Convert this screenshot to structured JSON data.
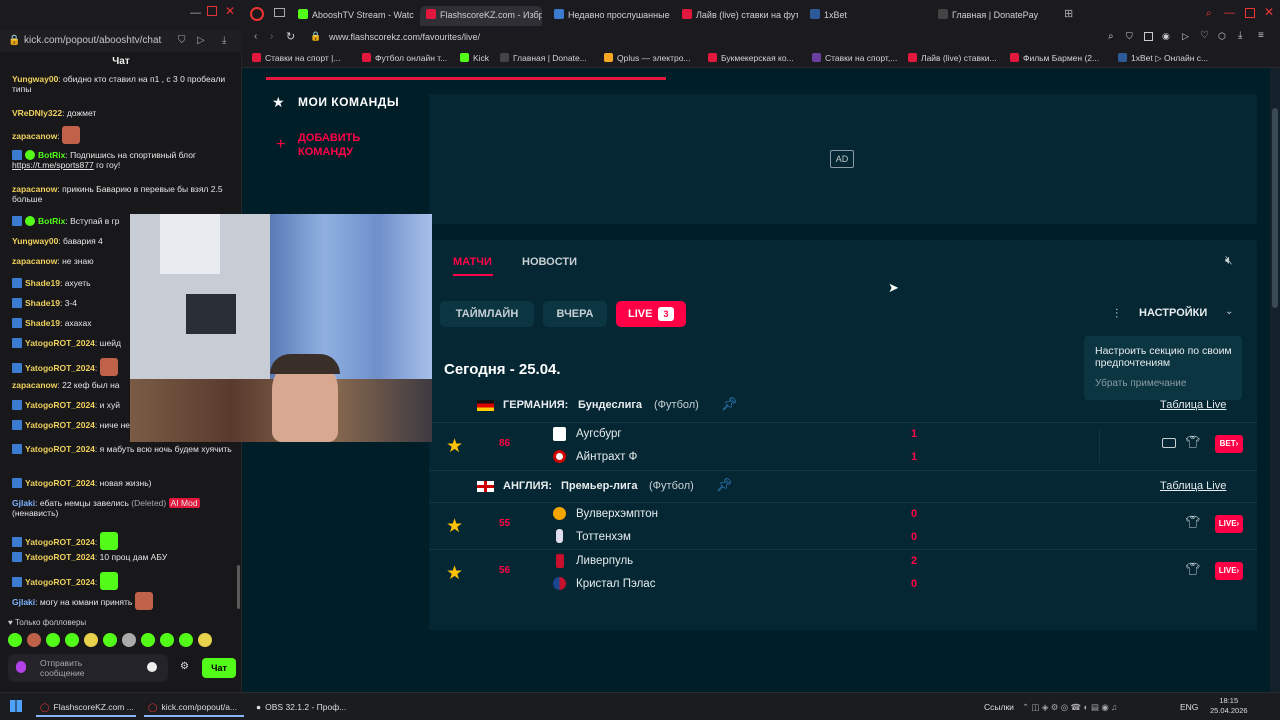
{
  "left_window": {
    "url": "kick.com/popout/abooshtv/chat",
    "title": "Чат",
    "messages": [
      {
        "user": "Yungway00",
        "text": "обидно кто ставил на п1 , с 3 0 пробеали типы",
        "color": "#f0d15c",
        "badge": "none"
      },
      {
        "user": "VReDNIy322",
        "text": "дожмет",
        "color": "#f0d15c",
        "badge": "none"
      },
      {
        "user": "zapacanow",
        "text": "",
        "color": "#f0d15c",
        "badge": "none",
        "emote": true
      },
      {
        "user": "BotRix",
        "text": "Подпишись на спортивный блог",
        "link": "https://t.me/sports877",
        "link_suffix": " го гоу!",
        "color": "#53fc18",
        "badge": "kick-green"
      },
      {
        "user": "zapacanow",
        "text": "прикинь Баварию в перевые бы взял 2.5 больше",
        "color": "#f0d15c",
        "badge": "none"
      },
      {
        "user": "BotRix",
        "text": "Вступай в гр",
        "color": "#53fc18",
        "badge": "kick-green"
      },
      {
        "user": "Yungway00",
        "text": "бавария 4",
        "color": "#f0d15c",
        "badge": "none"
      },
      {
        "user": "zapacanow",
        "text": "не знаю",
        "color": "#f0d15c",
        "badge": "none"
      },
      {
        "user": "Shade19",
        "text": "ахуеть",
        "color": "#f0d15c",
        "badge": "kick"
      },
      {
        "user": "Shade19",
        "text": "3-4",
        "color": "#f0d15c",
        "badge": "kick"
      },
      {
        "user": "Shade19",
        "text": "ахахах",
        "color": "#f0d15c",
        "badge": "kick"
      },
      {
        "user": "YatogoROT_2024",
        "text": "шейд",
        "color": "#f0d15c",
        "badge": "kick"
      },
      {
        "user": "YatogoROT_2024",
        "text": "",
        "color": "#f0d15c",
        "badge": "kick",
        "emote": true
      },
      {
        "user": "zapacanow",
        "text": "22 кеф был на",
        "color": "#f0d15c",
        "badge": "none"
      },
      {
        "user": "YatogoROT_2024",
        "text": "и хуй",
        "color": "#f0d15c",
        "badge": "kick"
      },
      {
        "user": "YatogoROT_2024",
        "text": "ниче не заказ",
        "color": "#f0d15c",
        "badge": "kick"
      },
      {
        "user": "YatogoROT_2024",
        "text": "я мабуть всю ночь будем хуячить",
        "color": "#f0d15c",
        "badge": "kick"
      },
      {
        "user": "YatogoROT_2024",
        "text": "новая жизнь)",
        "color": "#f0d15c",
        "badge": "kick"
      },
      {
        "user": "Gjlaki",
        "text": "ебать немцы завелись",
        "deleted": "(Deleted)",
        "mod": "AI Mod",
        "mod_note": "(ненависть)",
        "color": "#7fb3ff",
        "badge": "none"
      },
      {
        "user": "YatogoROT_2024",
        "text": "",
        "color": "#f0d15c",
        "badge": "kick",
        "emote": true
      },
      {
        "user": "YatogoROT_2024",
        "text": "10 проц дам АБУ",
        "color": "#f0d15c",
        "badge": "kick"
      },
      {
        "user": "YatogoROT_2024",
        "text": "",
        "color": "#f0d15c",
        "badge": "kick",
        "emote": true
      },
      {
        "user": "Gjlaki",
        "text": "могу на юмани принять",
        "color": "#7fb3ff",
        "badge": "none",
        "emote": true
      }
    ],
    "followers_only": "Только фолловеры",
    "input_placeholder": "Отправить сообщение",
    "chat_button": "Чат"
  },
  "browser": {
    "tabs": [
      {
        "label": "AbooshTV Stream - Watch",
        "color": "#53fc18"
      },
      {
        "label": "FlashscoreKZ.com - Избр",
        "color": "#e3183e",
        "active": true
      },
      {
        "label": "Недавно прослушанные",
        "color": "#3b7bd0"
      },
      {
        "label": "Лайв (live) ставки на фут",
        "color": "#e3183e"
      },
      {
        "label": "1xBet",
        "color": "#2e5a9a"
      },
      {
        "label": "Главная | DonatePay",
        "color": "#444"
      }
    ],
    "url": "www.flashscorekz.com/favourites/live/",
    "bookmarks": [
      {
        "label": "Ставки на спорт |...",
        "color": "#e3183e"
      },
      {
        "label": "Футбол онлайн т...",
        "color": "#e3183e"
      },
      {
        "label": "Kick",
        "color": "#53fc18"
      },
      {
        "label": "Главная | Donate...",
        "color": "#444"
      },
      {
        "label": "Qplus — электро...",
        "color": "#f5a623"
      },
      {
        "label": "Букмекерская ко...",
        "color": "#e3183e"
      },
      {
        "label": "Ставки на спорт,...",
        "color": "#6a3fa0"
      },
      {
        "label": "Лайв (live) ставки...",
        "color": "#e3183e"
      },
      {
        "label": "Фильм Бармен (2...",
        "color": "#e3183e"
      },
      {
        "label": "1xBet ▷ Онлайн с...",
        "color": "#2e5a9a"
      }
    ]
  },
  "page": {
    "my_teams": "МОИ КОМАНДЫ",
    "add_team": "ДОБАВИТЬ КОМАНДУ",
    "ad_label": "AD",
    "tabs": {
      "matches": "МАТЧИ",
      "news": "НОВОСТИ"
    },
    "filters": {
      "timeline": "ТАЙМЛАЙН",
      "yesterday": "ВЧЕРА",
      "live": "LIVE",
      "live_count": "3"
    },
    "settings": "НАСТРОЙКИ",
    "tooltip": {
      "text": "Настроить секцию по своим предпочтениям",
      "dismiss": "Убрать примечание"
    },
    "date_heading": "Сегодня - 25.04.",
    "leagues": [
      {
        "country": "ГЕРМАНИЯ:",
        "name": "Бундеслига",
        "sport": "(Футбол)",
        "table_link": "Таблица Live",
        "matches": [
          {
            "minute": "86",
            "home": "Аугсбург",
            "away": "Айнтрахт Ф",
            "home_score": "1",
            "away_score": "1",
            "action": "BET"
          }
        ]
      },
      {
        "country": "АНГЛИЯ:",
        "name": "Премьер-лига",
        "sport": "(Футбол)",
        "table_link": "Таблица Live",
        "matches": [
          {
            "minute": "55",
            "home": "Вулверхэмптон",
            "away": "Тоттенхэм",
            "home_score": "0",
            "away_score": "0",
            "action": "LIVE"
          },
          {
            "minute": "56",
            "home": "Ливерпуль",
            "away": "Кристал Пэлас",
            "home_score": "2",
            "away_score": "0",
            "action": "LIVE"
          }
        ]
      }
    ]
  },
  "taskbar": {
    "items": [
      "FlashscoreKZ.com ...",
      "kick.com/popout/a...",
      "OBS 32.1.2 - Проф..."
    ],
    "links": "Ссылки",
    "lang": "ENG",
    "time": "18:15",
    "date": "25.04.2026"
  },
  "colors": {
    "accent": "#ff0046",
    "bg": "#001e28",
    "star": "#ffc107"
  }
}
